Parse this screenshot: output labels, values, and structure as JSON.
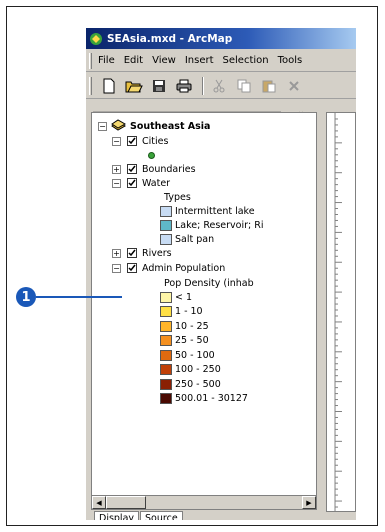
{
  "window": {
    "title": "SEAsia.mxd - ArcMap"
  },
  "menu": [
    "File",
    "Edit",
    "View",
    "Insert",
    "Selection",
    "Tools"
  ],
  "toolbar": {
    "buttons": [
      "new-icon",
      "open-icon",
      "save-icon",
      "print-icon",
      "cut-icon",
      "copy-icon",
      "paste-icon",
      "delete-icon"
    ]
  },
  "toc": {
    "dataframe": "Southeast Asia",
    "cities": {
      "label": "Cities",
      "symbol_color": "#3aa33a"
    },
    "boundaries": {
      "label": "Boundaries"
    },
    "water": {
      "label": "Water",
      "field": "Types",
      "classes": [
        {
          "label": "Intermittent lake",
          "color": "#c8dcf4"
        },
        {
          "label": "Lake; Reservoir; Ri",
          "color": "#5fb8c8"
        },
        {
          "label": "Salt pan",
          "color": "#c8dcf4"
        }
      ]
    },
    "rivers": {
      "label": "Rivers"
    },
    "admin": {
      "label": "Admin Population",
      "field": "Pop Density (inhab",
      "classes": [
        {
          "label": "< 1",
          "color": "#fff6a8"
        },
        {
          "label": "1 - 10",
          "color": "#ffe045"
        },
        {
          "label": "10 - 25",
          "color": "#ffb52a"
        },
        {
          "label": "25 - 50",
          "color": "#f49020"
        },
        {
          "label": "50 - 100",
          "color": "#e06a10"
        },
        {
          "label": "100 - 250",
          "color": "#c04008"
        },
        {
          "label": "250 - 500",
          "color": "#8a2004"
        },
        {
          "label": "500.01 - 30127",
          "color": "#4a0a02"
        }
      ]
    }
  },
  "tabs": [
    "Display",
    "Source"
  ],
  "callout": {
    "number": "1"
  }
}
